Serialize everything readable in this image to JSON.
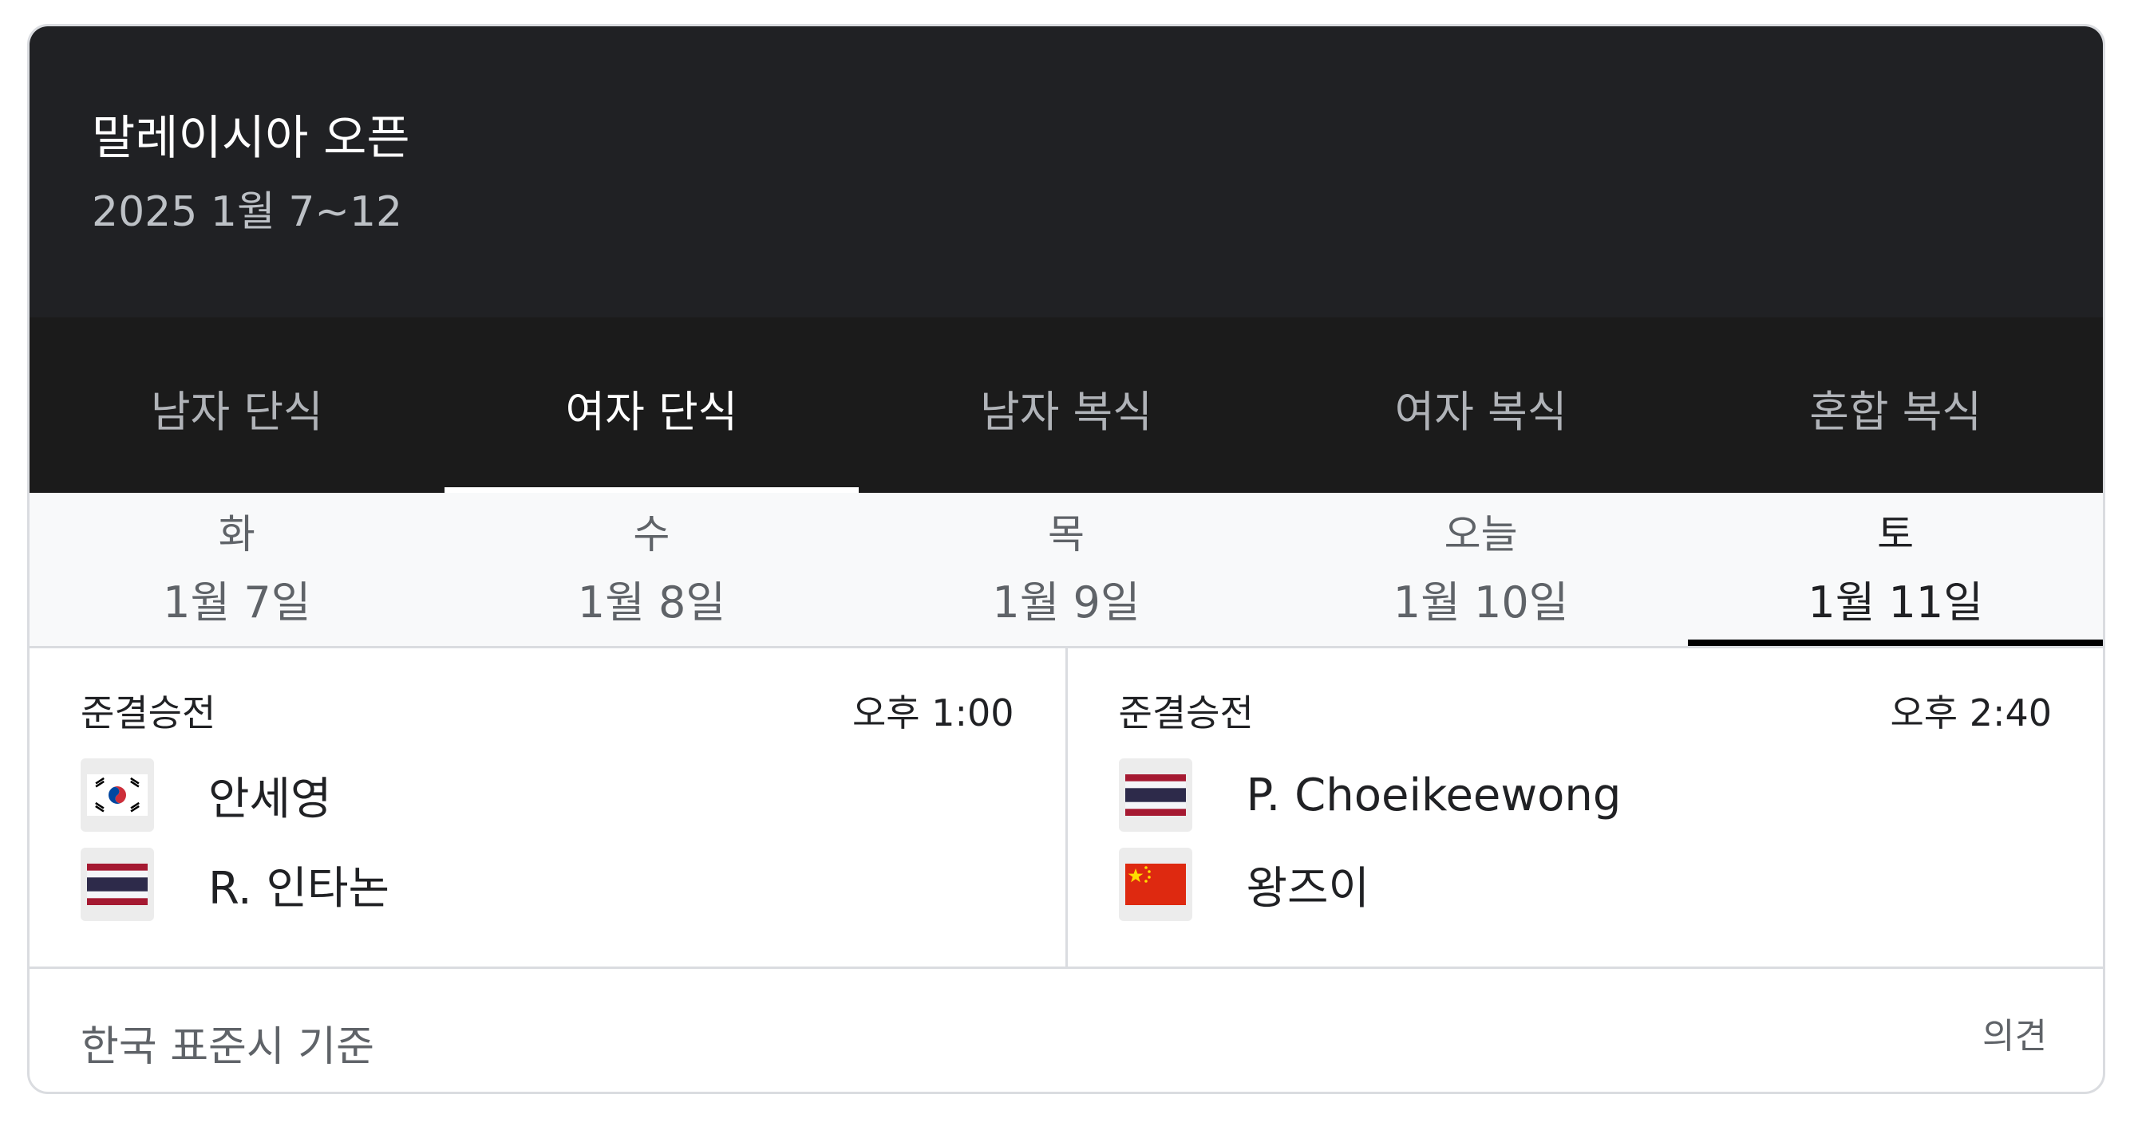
{
  "header": {
    "title": "말레이시아 오픈",
    "dates": "2025 1월 7~12"
  },
  "tabs": [
    {
      "label": "남자 단식",
      "active": false
    },
    {
      "label": "여자 단식",
      "active": true
    },
    {
      "label": "남자 복식",
      "active": false
    },
    {
      "label": "여자 복식",
      "active": false
    },
    {
      "label": "혼합 복식",
      "active": false
    }
  ],
  "days": [
    {
      "dow": "화",
      "date": "1월 7일",
      "active": false
    },
    {
      "dow": "수",
      "date": "1월 8일",
      "active": false
    },
    {
      "dow": "목",
      "date": "1월 9일",
      "active": false
    },
    {
      "dow": "오늘",
      "date": "1월 10일",
      "active": false
    },
    {
      "dow": "토",
      "date": "1월 11일",
      "active": true
    }
  ],
  "matches": [
    {
      "round": "준결승전",
      "time": "오후 1:00",
      "players": [
        {
          "name": "안세영",
          "flag_icon": "south-korea-flag-icon"
        },
        {
          "name": "R. 인타논",
          "flag_icon": "thailand-flag-icon"
        }
      ]
    },
    {
      "round": "준결승전",
      "time": "오후 2:40",
      "players": [
        {
          "name": "P. Choeikeewong",
          "flag_icon": "thailand-flag-icon"
        },
        {
          "name": "왕즈이",
          "flag_icon": "china-flag-icon"
        }
      ]
    }
  ],
  "footer": {
    "timezone": "한국 표준시 기준",
    "feedback": "의견"
  },
  "colors": {
    "header_bg": "#202124",
    "tabs_bg": "#1b1b1b",
    "days_bg": "#f8f9fa",
    "border": "#dadce0"
  }
}
